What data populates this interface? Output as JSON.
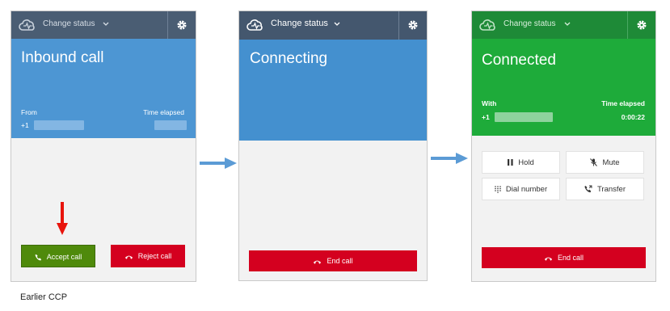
{
  "colors": {
    "topbar": "#4a5d73",
    "inbound_blue": "#4d96d3",
    "connected_green": "#1eab3a",
    "accept_green": "#4f8a0b",
    "reject_red": "#d4001f",
    "arrow_blue": "#5b9bd5",
    "indicator_red": "#e8140c"
  },
  "panel_inbound": {
    "status_label": "Change status",
    "title": "Inbound call",
    "from_label": "From",
    "from_prefix": "+1",
    "time_elapsed_label": "Time elapsed",
    "accept_label": "Accept call",
    "reject_label": "Reject call"
  },
  "panel_connecting": {
    "status_label": "Change status",
    "title": "Connecting",
    "end_label": "End call"
  },
  "panel_connected": {
    "status_label": "Change status",
    "title": "Connected",
    "with_label": "With",
    "with_prefix": "+1",
    "time_elapsed_label": "Time elapsed",
    "time_elapsed_value": "0:00:22",
    "hold_label": "Hold",
    "mute_label": "Mute",
    "dial_label": "Dial number",
    "transfer_label": "Transfer",
    "end_label": "End call"
  },
  "icons": [
    "cloud-logo-icon",
    "chevron-down-icon",
    "gear-icon",
    "phone-icon",
    "hang-up-icon",
    "pause-icon",
    "mute-icon",
    "dialpad-icon",
    "transfer-icon",
    "arrow-right-icon",
    "arrow-down-icon"
  ],
  "caption": "Earlier CCP"
}
